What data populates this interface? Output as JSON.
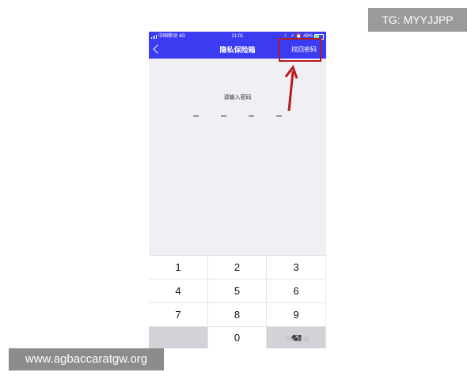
{
  "overlay": {
    "tg_label": "TG: MYYJJPP",
    "url_label": "www.agbaccaratgw.org"
  },
  "status_bar": {
    "carrier": "中国移动",
    "network": "4G",
    "time": "21:01",
    "battery": "49%"
  },
  "nav": {
    "title": "隐私保险箱",
    "recover_label": "找回密码"
  },
  "lock": {
    "prompt": "请输入密码",
    "pin_length": 4
  },
  "keypad": {
    "keys": [
      "1",
      "2",
      "3",
      "4",
      "5",
      "6",
      "7",
      "8",
      "9",
      "",
      "0",
      ""
    ],
    "delete_icon": "backspace-icon",
    "watermark": "Bai 经验"
  },
  "colors": {
    "nav_blue": "#3b3bf2",
    "annotation_red": "#b8191f"
  }
}
